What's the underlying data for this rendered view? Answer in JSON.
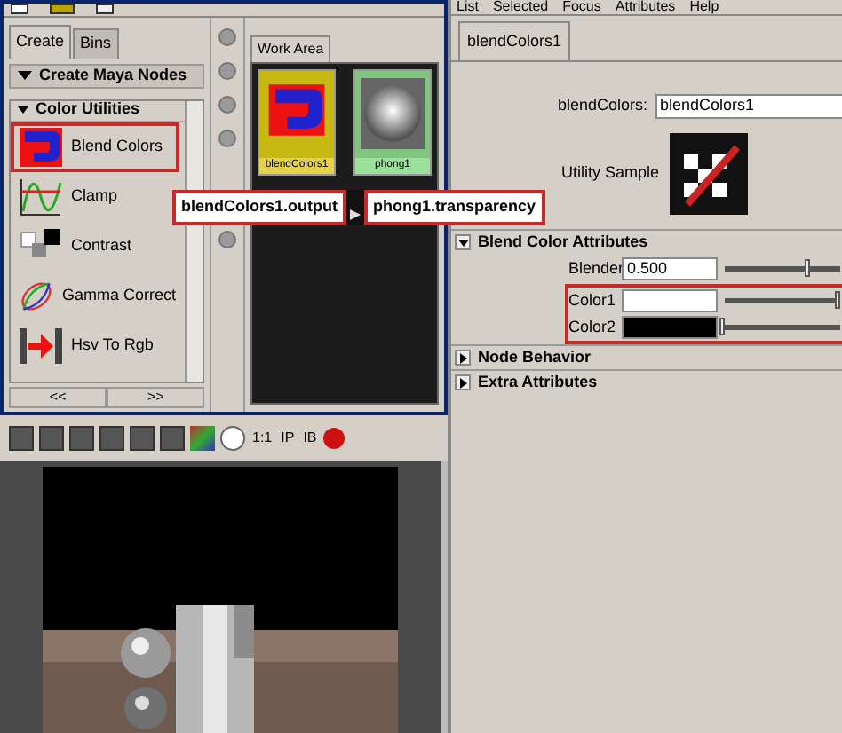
{
  "hypershade": {
    "tabs": [
      {
        "label": "Create",
        "selected": true
      },
      {
        "label": "Bins",
        "selected": false
      }
    ],
    "section": "Create Maya Nodes",
    "group": "Color Utilities",
    "nodes": [
      {
        "label": "Blend Colors",
        "kind": "blend",
        "selected": true
      },
      {
        "label": "Clamp",
        "kind": "clamp",
        "selected": false
      },
      {
        "label": "Contrast",
        "kind": "contrast",
        "selected": false
      },
      {
        "label": "Gamma Correct",
        "kind": "gamma",
        "selected": false
      },
      {
        "label": "Hsv To Rgb",
        "kind": "hsv",
        "selected": false
      }
    ],
    "pager": [
      "<<",
      ">>"
    ],
    "work_area": {
      "tab": "Work Area",
      "nodes": [
        {
          "label": "blendColors1",
          "kind": "blend"
        },
        {
          "label": "phong1",
          "kind": "phong"
        }
      ]
    },
    "connection": {
      "source": "blendColors1.output",
      "target": "phong1.transparency"
    }
  },
  "attribute_editor": {
    "menu": [
      "List",
      "Selected",
      "Focus",
      "Attributes",
      "Help"
    ],
    "tab": "blendColors1",
    "type_label": "blendColors:",
    "name_value": "blendColors1",
    "sample_label": "Utility Sample",
    "sections": [
      {
        "title": "Blend Color Attributes",
        "expanded": true,
        "rows": [
          {
            "kind": "number",
            "label": "Blender",
            "value": "0.500",
            "level": 0.75,
            "highlighted": false
          },
          {
            "kind": "color",
            "label": "Color1",
            "color": "#ffffff",
            "level": 1,
            "highlighted": true
          },
          {
            "kind": "color",
            "label": "Color2",
            "color": "#000000",
            "level": 0,
            "highlighted": true
          }
        ]
      },
      {
        "title": "Node Behavior",
        "expanded": false
      },
      {
        "title": "Extra Attributes",
        "expanded": false
      }
    ]
  },
  "render_view": {
    "toolbar_texts": [
      "1:1",
      "IP",
      "IB"
    ]
  }
}
